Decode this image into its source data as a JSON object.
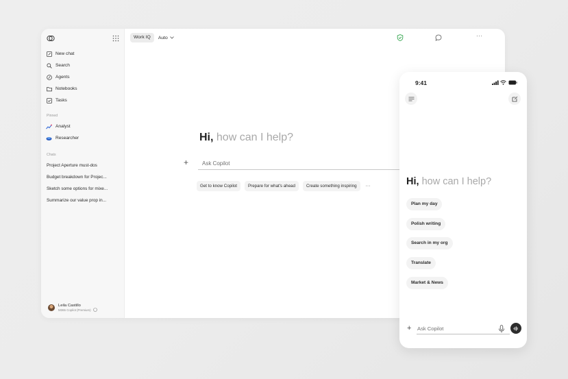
{
  "sidebar": {
    "nav": [
      {
        "label": "New chat",
        "icon": "edit-icon"
      },
      {
        "label": "Search",
        "icon": "search-icon"
      },
      {
        "label": "Agents",
        "icon": "agents-icon"
      },
      {
        "label": "Notebooks",
        "icon": "folder-icon"
      },
      {
        "label": "Tasks",
        "icon": "checkbox-icon"
      }
    ],
    "pinned_label": "Pinned",
    "pinned": [
      {
        "label": "Analyst",
        "icon": "analyst-icon"
      },
      {
        "label": "Researcher",
        "icon": "researcher-icon"
      }
    ],
    "chats_label": "Chats",
    "chats": [
      "Project Aperture must-dos",
      "Budget breakdown for Projec...",
      "Sketch some options for mixe...",
      "Summarize our value prop in..."
    ],
    "user": {
      "name": "Leila Castillo",
      "plan": "M365 Copilot (Premium)"
    }
  },
  "topbar": {
    "chip": "Work IQ",
    "model": "Auto",
    "more": "···"
  },
  "main": {
    "greeting_hi": "Hi,",
    "greeting_sub": "how can I help?",
    "placeholder": "Ask Copilot",
    "suggestions": [
      "Get to know Copilot",
      "Prepare for what's ahead",
      "Create something inspiring"
    ],
    "more": "···"
  },
  "phone": {
    "time": "9:41",
    "greeting_hi": "Hi,",
    "greeting_sub": "how can I help?",
    "chips": [
      "Plan my day",
      "Polish writing",
      "Search in my org",
      "Translate",
      "Market & News"
    ],
    "placeholder": "Ask Copilot"
  },
  "colors": {
    "accent_green": "#2fa34a",
    "analyst_blue": "#3b6fd8",
    "researcher_blue": "#2a5bbf"
  }
}
